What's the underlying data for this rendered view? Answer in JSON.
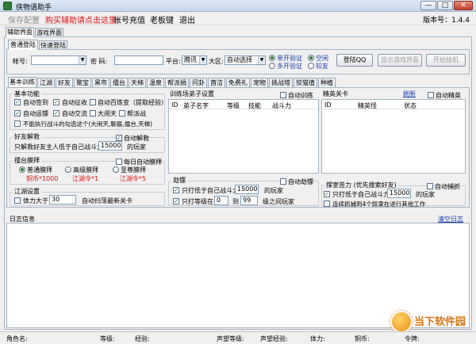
{
  "window": {
    "title": "侠物语助手",
    "min": "—",
    "max": "□",
    "close": "✕"
  },
  "menu": {
    "save_config": "保存配置",
    "buy_red": "购买辅助请点击这里",
    "recharge": "帐号充值",
    "boss_key": "老板键",
    "exit": "退出",
    "version": "版本号：1.4.4"
  },
  "tabs": {
    "aux": "辅助界面",
    "game": "游戏界面"
  },
  "login_tabs": {
    "normal": "普通登陆",
    "quick": "快速登陆"
  },
  "login": {
    "account_label": "帐号:",
    "password_label": "密  码:",
    "platform_label": "平台:",
    "platform_value": "腾讯",
    "zone_label": "大区:",
    "zone_value": "自动选择",
    "radio1": "单开验证",
    "radio2": "多开验证",
    "radio3": "空闲",
    "radio4": "较友",
    "login_btn": "登陆QQ",
    "show_btn": "显示游戏界面",
    "start_btn": "开始挂机"
  },
  "func_tabs": [
    "基本训练",
    "江湖",
    "好友",
    "聚宝",
    "黑市",
    "擂台",
    "天梯",
    "温泉",
    "帮派捐献",
    "问卦",
    "酋洁",
    "免费礼物",
    "宠物",
    "挑战塔",
    "狡猫值",
    "种植"
  ],
  "basic": {
    "title": "基本功能",
    "items": [
      "自动签到",
      "自动征收",
      "自动百炼变（提取经验）",
      "自动运镖",
      "自动交流",
      "大闹天",
      "帮派战"
    ],
    "hint": "不能执行战斗的勾选这个(大闹天,聊届,擂台,天梯)"
  },
  "friend": {
    "title": "好友解救",
    "auto": "自动解救",
    "text": "只解救好友主人低于自己战斗力",
    "value": "15000",
    "suffix": "的玩家"
  },
  "arena": {
    "title": "擂台膜拜",
    "daily": "每日自动膜拜",
    "opt1": "普通膜拜",
    "opt2": "高级膜拜",
    "opt3": "至尊膜拜",
    "cost1": "铜币*1000",
    "cost2": "江湖令*1",
    "cost3": "江湖令*5"
  },
  "jianghu": {
    "title": "江湖设置",
    "stamina": "体力大于",
    "value": "30",
    "text": "自动扫荡最新关卡"
  },
  "train": {
    "title": "训练场弟子设置",
    "auto": "自动训练",
    "headers": [
      "ID",
      "弟子名字",
      "等级",
      "技能",
      "战斗力"
    ]
  },
  "elite": {
    "title": "精英关卡",
    "refresh": "刷新",
    "auto": "自动精英",
    "headers": [
      "ID",
      "精英怪",
      "状态"
    ]
  },
  "escort": {
    "title": "劫镖",
    "auto": "自动劫镖",
    "only_power": "只打低于自己战斗力",
    "power_value": "15000",
    "power_suffix": "的玩家",
    "only_level": "只打等级在",
    "lv_from": "0",
    "lv_to_label": "到",
    "lv_to": "99",
    "lv_suffix": "级之间玩家"
  },
  "catch": {
    "title": "撑室苦力 (优先搜索好友)",
    "auto": "自动捕抓",
    "only_power": "只打低于自己战斗力",
    "value": "15000",
    "suffix": "的玩家",
    "fail": "连续抓捕到4个奴隶在进行其他工作"
  },
  "log": {
    "title": "日志信息",
    "clear": "清空日志"
  },
  "status": {
    "name": "角色名:",
    "level": "等级:",
    "exp": "经验:",
    "fame_level": "声望等级:",
    "fame_exp": "声望经验:",
    "stamina": "体力:",
    "coin": "铜币:",
    "token": "令牌:"
  },
  "watermark": "当下软件园"
}
